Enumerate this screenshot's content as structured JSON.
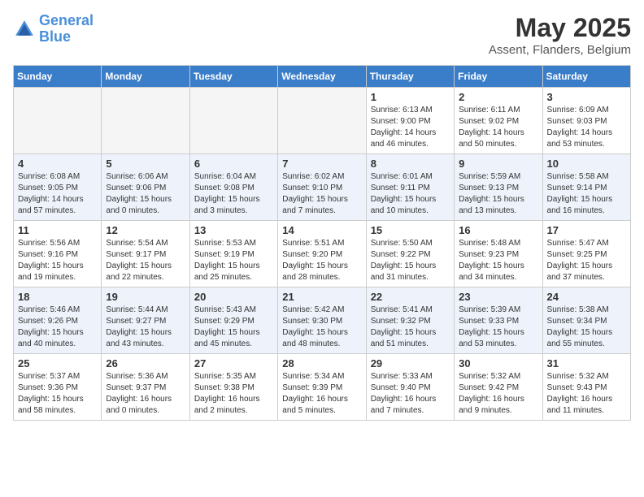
{
  "logo": {
    "line1": "General",
    "line2": "Blue"
  },
  "title": "May 2025",
  "location": "Assent, Flanders, Belgium",
  "weekdays": [
    "Sunday",
    "Monday",
    "Tuesday",
    "Wednesday",
    "Thursday",
    "Friday",
    "Saturday"
  ],
  "weeks": [
    [
      {
        "day": "",
        "info": ""
      },
      {
        "day": "",
        "info": ""
      },
      {
        "day": "",
        "info": ""
      },
      {
        "day": "",
        "info": ""
      },
      {
        "day": "1",
        "info": "Sunrise: 6:13 AM\nSunset: 9:00 PM\nDaylight: 14 hours\nand 46 minutes."
      },
      {
        "day": "2",
        "info": "Sunrise: 6:11 AM\nSunset: 9:02 PM\nDaylight: 14 hours\nand 50 minutes."
      },
      {
        "day": "3",
        "info": "Sunrise: 6:09 AM\nSunset: 9:03 PM\nDaylight: 14 hours\nand 53 minutes."
      }
    ],
    [
      {
        "day": "4",
        "info": "Sunrise: 6:08 AM\nSunset: 9:05 PM\nDaylight: 14 hours\nand 57 minutes."
      },
      {
        "day": "5",
        "info": "Sunrise: 6:06 AM\nSunset: 9:06 PM\nDaylight: 15 hours\nand 0 minutes."
      },
      {
        "day": "6",
        "info": "Sunrise: 6:04 AM\nSunset: 9:08 PM\nDaylight: 15 hours\nand 3 minutes."
      },
      {
        "day": "7",
        "info": "Sunrise: 6:02 AM\nSunset: 9:10 PM\nDaylight: 15 hours\nand 7 minutes."
      },
      {
        "day": "8",
        "info": "Sunrise: 6:01 AM\nSunset: 9:11 PM\nDaylight: 15 hours\nand 10 minutes."
      },
      {
        "day": "9",
        "info": "Sunrise: 5:59 AM\nSunset: 9:13 PM\nDaylight: 15 hours\nand 13 minutes."
      },
      {
        "day": "10",
        "info": "Sunrise: 5:58 AM\nSunset: 9:14 PM\nDaylight: 15 hours\nand 16 minutes."
      }
    ],
    [
      {
        "day": "11",
        "info": "Sunrise: 5:56 AM\nSunset: 9:16 PM\nDaylight: 15 hours\nand 19 minutes."
      },
      {
        "day": "12",
        "info": "Sunrise: 5:54 AM\nSunset: 9:17 PM\nDaylight: 15 hours\nand 22 minutes."
      },
      {
        "day": "13",
        "info": "Sunrise: 5:53 AM\nSunset: 9:19 PM\nDaylight: 15 hours\nand 25 minutes."
      },
      {
        "day": "14",
        "info": "Sunrise: 5:51 AM\nSunset: 9:20 PM\nDaylight: 15 hours\nand 28 minutes."
      },
      {
        "day": "15",
        "info": "Sunrise: 5:50 AM\nSunset: 9:22 PM\nDaylight: 15 hours\nand 31 minutes."
      },
      {
        "day": "16",
        "info": "Sunrise: 5:48 AM\nSunset: 9:23 PM\nDaylight: 15 hours\nand 34 minutes."
      },
      {
        "day": "17",
        "info": "Sunrise: 5:47 AM\nSunset: 9:25 PM\nDaylight: 15 hours\nand 37 minutes."
      }
    ],
    [
      {
        "day": "18",
        "info": "Sunrise: 5:46 AM\nSunset: 9:26 PM\nDaylight: 15 hours\nand 40 minutes."
      },
      {
        "day": "19",
        "info": "Sunrise: 5:44 AM\nSunset: 9:27 PM\nDaylight: 15 hours\nand 43 minutes."
      },
      {
        "day": "20",
        "info": "Sunrise: 5:43 AM\nSunset: 9:29 PM\nDaylight: 15 hours\nand 45 minutes."
      },
      {
        "day": "21",
        "info": "Sunrise: 5:42 AM\nSunset: 9:30 PM\nDaylight: 15 hours\nand 48 minutes."
      },
      {
        "day": "22",
        "info": "Sunrise: 5:41 AM\nSunset: 9:32 PM\nDaylight: 15 hours\nand 51 minutes."
      },
      {
        "day": "23",
        "info": "Sunrise: 5:39 AM\nSunset: 9:33 PM\nDaylight: 15 hours\nand 53 minutes."
      },
      {
        "day": "24",
        "info": "Sunrise: 5:38 AM\nSunset: 9:34 PM\nDaylight: 15 hours\nand 55 minutes."
      }
    ],
    [
      {
        "day": "25",
        "info": "Sunrise: 5:37 AM\nSunset: 9:36 PM\nDaylight: 15 hours\nand 58 minutes."
      },
      {
        "day": "26",
        "info": "Sunrise: 5:36 AM\nSunset: 9:37 PM\nDaylight: 16 hours\nand 0 minutes."
      },
      {
        "day": "27",
        "info": "Sunrise: 5:35 AM\nSunset: 9:38 PM\nDaylight: 16 hours\nand 2 minutes."
      },
      {
        "day": "28",
        "info": "Sunrise: 5:34 AM\nSunset: 9:39 PM\nDaylight: 16 hours\nand 5 minutes."
      },
      {
        "day": "29",
        "info": "Sunrise: 5:33 AM\nSunset: 9:40 PM\nDaylight: 16 hours\nand 7 minutes."
      },
      {
        "day": "30",
        "info": "Sunrise: 5:32 AM\nSunset: 9:42 PM\nDaylight: 16 hours\nand 9 minutes."
      },
      {
        "day": "31",
        "info": "Sunrise: 5:32 AM\nSunset: 9:43 PM\nDaylight: 16 hours\nand 11 minutes."
      }
    ]
  ]
}
